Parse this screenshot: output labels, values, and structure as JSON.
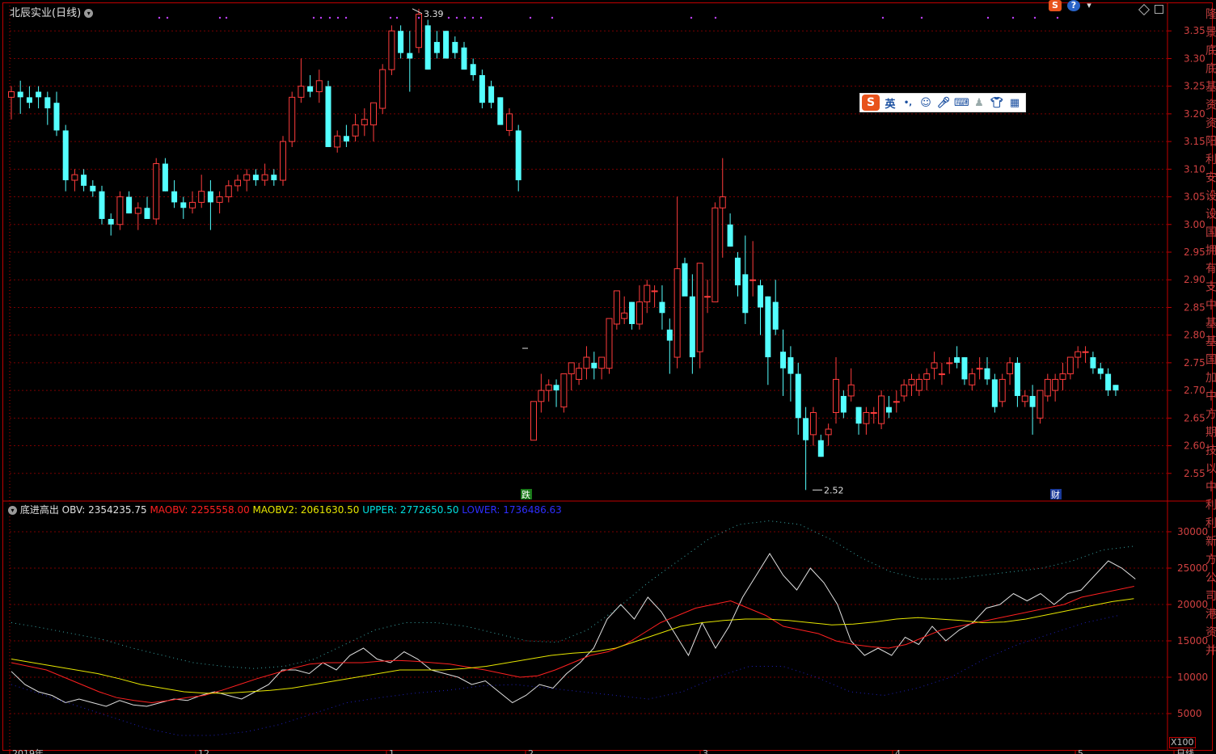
{
  "header": {
    "stock_name": "北辰实业",
    "period": "(日线)",
    "high_label": "3.39",
    "low_label": "2.52"
  },
  "indicator": {
    "name": "底进高出",
    "obv": "OBV: 2354235.75",
    "maobv": "MAOBV: 2255558.00",
    "maobv2": "MAOBV2: 2061630.50",
    "upper": "UPPER: 2772650.50",
    "lower": "LOWER: 1736486.63",
    "multiplier": "X100"
  },
  "markers": {
    "m1": "跌",
    "m2": "财"
  },
  "ime": {
    "logo": "S",
    "lang": "英",
    "punct": "•,"
  },
  "x_labels": [
    "2019年",
    "12",
    "1",
    "2",
    "3",
    "4",
    "5",
    "日线"
  ],
  "price_ticks": [
    "3.35",
    "3.30",
    "3.25",
    "3.20",
    "3.15",
    "3.10",
    "3.05",
    "3.00",
    "2.95",
    "2.90",
    "2.85",
    "2.80",
    "2.75",
    "2.70",
    "2.65",
    "2.60",
    "2.55"
  ],
  "obv_ticks": [
    "30000",
    "25000",
    "20000",
    "15000",
    "10000",
    "5000"
  ],
  "right_strip": "隆景底底基资资阳利安设设国拥有支中基基国 加 中方 期技 以 中利 利新方 公 司 港 资 并 本 投 开 技 投 新 业 业 股 资 资 产 运 中 市",
  "colors": {
    "up": "#ff3c3c",
    "down": "#54ffff",
    "grid": "#7a0000",
    "axis": "#c00000",
    "obv": "#e0e0e0",
    "maobv": "#ff2020",
    "maobv2": "#e6e600",
    "upper": "#00ffff",
    "lower": "#3030ff"
  },
  "chart_data": [
    {
      "type": "candlestick",
      "title": "北辰实业 (日线)",
      "ylim": [
        2.5,
        3.4
      ],
      "candles": [
        [
          3.23,
          3.25,
          3.19,
          3.24
        ],
        [
          3.24,
          3.26,
          3.2,
          3.23
        ],
        [
          3.23,
          3.25,
          3.21,
          3.22
        ],
        [
          3.24,
          3.25,
          3.21,
          3.23
        ],
        [
          3.23,
          3.24,
          3.18,
          3.21
        ],
        [
          3.22,
          3.24,
          3.16,
          3.17
        ],
        [
          3.17,
          3.18,
          3.06,
          3.08
        ],
        [
          3.08,
          3.1,
          3.06,
          3.09
        ],
        [
          3.09,
          3.1,
          3.06,
          3.07
        ],
        [
          3.07,
          3.08,
          3.05,
          3.06
        ],
        [
          3.06,
          3.07,
          3.0,
          3.01
        ],
        [
          3.01,
          3.02,
          2.98,
          3.0
        ],
        [
          3.0,
          3.06,
          2.99,
          3.05
        ],
        [
          3.05,
          3.06,
          3.02,
          3.02
        ],
        [
          3.02,
          3.04,
          2.99,
          3.03
        ],
        [
          3.03,
          3.05,
          3.01,
          3.01
        ],
        [
          3.01,
          3.12,
          3.0,
          3.11
        ],
        [
          3.11,
          3.12,
          3.06,
          3.06
        ],
        [
          3.06,
          3.08,
          3.03,
          3.04
        ],
        [
          3.04,
          3.05,
          3.01,
          3.03
        ],
        [
          3.03,
          3.06,
          3.02,
          3.04
        ],
        [
          3.04,
          3.09,
          3.03,
          3.06
        ],
        [
          3.06,
          3.08,
          2.99,
          3.04
        ],
        [
          3.04,
          3.06,
          3.02,
          3.05
        ],
        [
          3.05,
          3.08,
          3.04,
          3.07
        ],
        [
          3.07,
          3.09,
          3.06,
          3.08
        ],
        [
          3.08,
          3.1,
          3.06,
          3.09
        ],
        [
          3.09,
          3.1,
          3.07,
          3.08
        ],
        [
          3.08,
          3.11,
          3.07,
          3.09
        ],
        [
          3.09,
          3.1,
          3.07,
          3.08
        ],
        [
          3.08,
          3.16,
          3.07,
          3.15
        ],
        [
          3.15,
          3.24,
          3.14,
          3.23
        ],
        [
          3.23,
          3.3,
          3.22,
          3.25
        ],
        [
          3.25,
          3.27,
          3.23,
          3.24
        ],
        [
          3.24,
          3.28,
          3.22,
          3.26
        ],
        [
          3.25,
          3.26,
          3.14,
          3.14
        ],
        [
          3.14,
          3.17,
          3.13,
          3.16
        ],
        [
          3.16,
          3.18,
          3.14,
          3.15
        ],
        [
          3.16,
          3.2,
          3.15,
          3.18
        ],
        [
          3.18,
          3.21,
          3.16,
          3.19
        ],
        [
          3.18,
          3.22,
          3.15,
          3.22
        ],
        [
          3.21,
          3.29,
          3.2,
          3.28
        ],
        [
          3.28,
          3.36,
          3.27,
          3.35
        ],
        [
          3.35,
          3.36,
          3.3,
          3.31
        ],
        [
          3.31,
          3.35,
          3.24,
          3.3
        ],
        [
          3.32,
          3.39,
          3.31,
          3.38
        ],
        [
          3.36,
          3.37,
          3.28,
          3.28
        ],
        [
          3.33,
          3.35,
          3.3,
          3.31
        ],
        [
          3.35,
          3.35,
          3.3,
          3.3
        ],
        [
          3.33,
          3.34,
          3.3,
          3.31
        ],
        [
          3.32,
          3.33,
          3.28,
          3.28
        ],
        [
          3.29,
          3.3,
          3.26,
          3.27
        ],
        [
          3.27,
          3.28,
          3.21,
          3.22
        ],
        [
          3.25,
          3.26,
          3.21,
          3.22
        ],
        [
          3.23,
          3.23,
          3.18,
          3.18
        ],
        [
          3.17,
          3.21,
          3.16,
          3.2
        ],
        [
          3.17,
          3.18,
          3.06,
          3.08
        ]
      ]
    },
    {
      "type": "candlestick",
      "ylim": [
        2.5,
        3.4
      ],
      "candles": [
        [
          2.61,
          2.68,
          2.61,
          2.68
        ],
        [
          2.68,
          2.73,
          2.66,
          2.7
        ],
        [
          2.7,
          2.72,
          2.68,
          2.71
        ],
        [
          2.71,
          2.72,
          2.67,
          2.7
        ],
        [
          2.67,
          2.73,
          2.66,
          2.73
        ],
        [
          2.73,
          2.75,
          2.7,
          2.75
        ],
        [
          2.72,
          2.75,
          2.71,
          2.74
        ],
        [
          2.74,
          2.78,
          2.72,
          2.76
        ],
        [
          2.75,
          2.77,
          2.72,
          2.74
        ],
        [
          2.74,
          2.76,
          2.72,
          2.76
        ],
        [
          2.74,
          2.83,
          2.73,
          2.83
        ],
        [
          2.82,
          2.88,
          2.81,
          2.88
        ],
        [
          2.83,
          2.87,
          2.82,
          2.84
        ],
        [
          2.86,
          2.86,
          2.81,
          2.82
        ],
        [
          2.82,
          2.89,
          2.81,
          2.86
        ],
        [
          2.86,
          2.9,
          2.84,
          2.89
        ],
        [
          2.88,
          2.89,
          2.85,
          2.88
        ],
        [
          2.86,
          2.89,
          2.81,
          2.84
        ],
        [
          2.81,
          2.83,
          2.73,
          2.79
        ],
        [
          2.76,
          3.05,
          2.74,
          2.92
        ],
        [
          2.93,
          2.94,
          2.88,
          2.87
        ],
        [
          2.87,
          2.91,
          2.73,
          2.76
        ],
        [
          2.77,
          2.93,
          2.74,
          2.93
        ],
        [
          2.87,
          2.9,
          2.84,
          2.87
        ],
        [
          2.86,
          3.04,
          2.86,
          3.03
        ],
        [
          3.03,
          3.12,
          2.94,
          3.05
        ],
        [
          3.0,
          3.02,
          2.96,
          2.96
        ],
        [
          2.94,
          2.95,
          2.87,
          2.89
        ],
        [
          2.91,
          2.98,
          2.82,
          2.84
        ],
        [
          2.9,
          2.97,
          2.87,
          2.9
        ],
        [
          2.89,
          2.9,
          2.8,
          2.85
        ],
        [
          2.87,
          2.87,
          2.71,
          2.76
        ],
        [
          2.86,
          2.9,
          2.8,
          2.81
        ],
        [
          2.77,
          2.81,
          2.69,
          2.74
        ],
        [
          2.76,
          2.78,
          2.68,
          2.73
        ],
        [
          2.73,
          2.75,
          2.62,
          2.65
        ],
        [
          2.65,
          2.67,
          2.52,
          2.61
        ],
        [
          2.62,
          2.67,
          2.6,
          2.66
        ],
        [
          2.61,
          2.62,
          2.58,
          2.58
        ],
        [
          2.62,
          2.64,
          2.6,
          2.63
        ],
        [
          2.66,
          2.76,
          2.64,
          2.72
        ],
        [
          2.69,
          2.7,
          2.65,
          2.66
        ],
        [
          2.69,
          2.74,
          2.68,
          2.71
        ],
        [
          2.67,
          2.67,
          2.62,
          2.64
        ],
        [
          2.64,
          2.67,
          2.62,
          2.66
        ],
        [
          2.66,
          2.67,
          2.64,
          2.66
        ],
        [
          2.64,
          2.7,
          2.63,
          2.69
        ],
        [
          2.67,
          2.69,
          2.65,
          2.66
        ],
        [
          2.68,
          2.7,
          2.66,
          2.68
        ],
        [
          2.69,
          2.72,
          2.68,
          2.71
        ],
        [
          2.71,
          2.73,
          2.69,
          2.72
        ],
        [
          2.7,
          2.73,
          2.69,
          2.72
        ],
        [
          2.72,
          2.74,
          2.7,
          2.73
        ],
        [
          2.74,
          2.77,
          2.72,
          2.75
        ],
        [
          2.73,
          2.75,
          2.71,
          2.73
        ],
        [
          2.75,
          2.76,
          2.73,
          2.75
        ],
        [
          2.76,
          2.78,
          2.74,
          2.75
        ],
        [
          2.76,
          2.76,
          2.71,
          2.72
        ],
        [
          2.71,
          2.74,
          2.7,
          2.73
        ],
        [
          2.74,
          2.76,
          2.72,
          2.74
        ],
        [
          2.74,
          2.76,
          2.71,
          2.72
        ],
        [
          2.72,
          2.73,
          2.66,
          2.67
        ],
        [
          2.68,
          2.73,
          2.67,
          2.72
        ],
        [
          2.73,
          2.76,
          2.71,
          2.75
        ],
        [
          2.75,
          2.76,
          2.67,
          2.69
        ],
        [
          2.68,
          2.7,
          2.67,
          2.69
        ],
        [
          2.69,
          2.71,
          2.62,
          2.67
        ],
        [
          2.65,
          2.7,
          2.64,
          2.7
        ],
        [
          2.69,
          2.73,
          2.68,
          2.72
        ],
        [
          2.7,
          2.73,
          2.68,
          2.72
        ],
        [
          2.72,
          2.75,
          2.7,
          2.73
        ],
        [
          2.73,
          2.76,
          2.72,
          2.76
        ],
        [
          2.76,
          2.78,
          2.74,
          2.77
        ],
        [
          2.77,
          2.78,
          2.75,
          2.77
        ],
        [
          2.76,
          2.77,
          2.73,
          2.74
        ],
        [
          2.74,
          2.75,
          2.72,
          2.73
        ],
        [
          2.73,
          2.74,
          2.69,
          2.7
        ],
        [
          2.71,
          2.71,
          2.69,
          2.7
        ]
      ]
    },
    {
      "type": "line",
      "ylim": [
        0,
        34000
      ],
      "series": [
        {
          "name": "OBV",
          "values": [
            10800,
            9000,
            8000,
            7500,
            6500,
            7000,
            6500,
            6000,
            6800,
            6200,
            6000,
            6500,
            7000,
            6800,
            7500,
            8000,
            7500,
            7000,
            8000,
            9000,
            11000,
            11000,
            10500,
            12000,
            11000,
            13000,
            14000,
            12500,
            12000,
            13500,
            12500,
            11000,
            10500,
            10000,
            9000,
            9500,
            8000,
            6500,
            7500,
            9000,
            8500,
            10500,
            12000,
            14000,
            18000,
            20000,
            18000,
            21000,
            19000,
            16000,
            13000,
            17500,
            14000,
            17000,
            21000,
            24000,
            27000,
            24000,
            22000,
            25000,
            23000,
            20000,
            15000,
            13000,
            14000,
            13000,
            15500,
            14500,
            17000,
            15000,
            16500,
            17500,
            19500,
            20000,
            21500,
            20500,
            21500,
            20000,
            21500,
            22000,
            24000,
            26000,
            25000,
            23500
          ]
        },
        {
          "name": "MAOBV",
          "values": [
            12000,
            11500,
            11000,
            10000,
            9000,
            8000,
            7200,
            6800,
            6500,
            6800,
            7200,
            7500,
            8200,
            9000,
            9800,
            10500,
            11200,
            11800,
            12000,
            12000,
            12000,
            12200,
            12300,
            12200,
            12000,
            11800,
            11400,
            11000,
            10500,
            10000,
            10200,
            11000,
            12000,
            13000,
            13500,
            14500,
            16000,
            17500,
            18500,
            19500,
            20000,
            20500,
            19500,
            18500,
            17000,
            16500,
            16000,
            15000,
            14500,
            14200,
            14000,
            14500,
            15500,
            16500,
            17000,
            17500,
            18000,
            18500,
            19000,
            19500,
            20000,
            21000,
            21500,
            22000,
            22500
          ]
        },
        {
          "name": "MAOBV2",
          "values": [
            12500,
            12000,
            11500,
            11000,
            10500,
            9800,
            9000,
            8500,
            8000,
            7800,
            7800,
            8000,
            8200,
            8500,
            9000,
            9500,
            10000,
            10500,
            11000,
            11000,
            11000,
            11200,
            11500,
            12000,
            12500,
            13000,
            13300,
            13500,
            14000,
            15000,
            16000,
            17000,
            17500,
            17800,
            18000,
            18000,
            17800,
            17500,
            17200,
            17300,
            17600,
            18000,
            18200,
            18000,
            17800,
            17500,
            17600,
            18000,
            18600,
            19200,
            19800,
            20400,
            20800
          ]
        }
      ]
    }
  ]
}
